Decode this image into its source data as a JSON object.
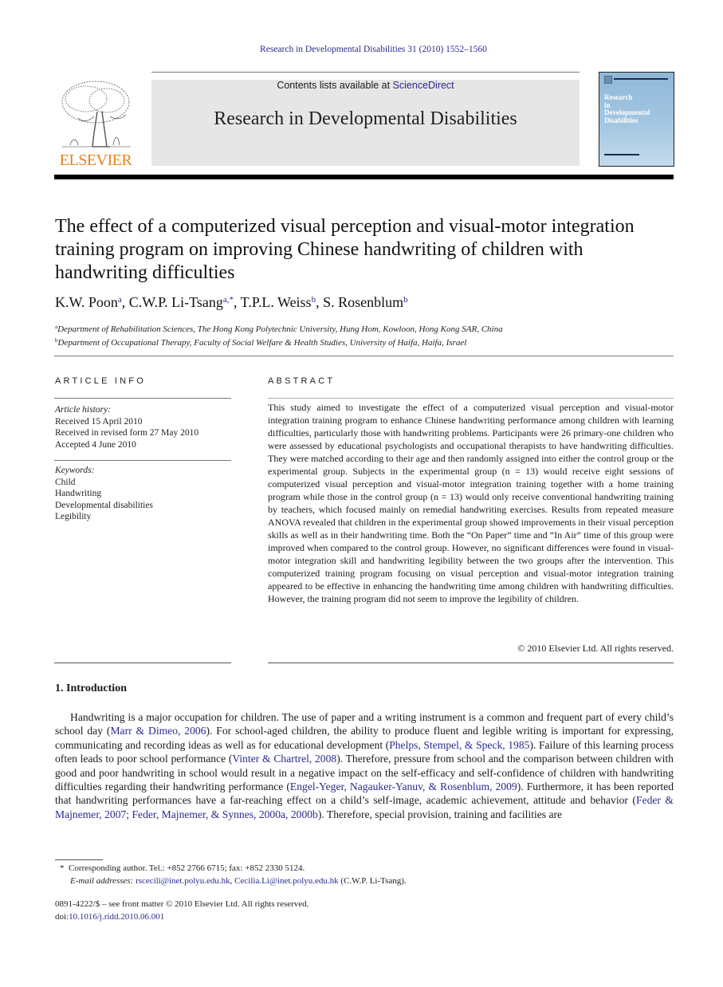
{
  "header": {
    "journal_ref": "Research in Developmental Disabilities 31 (2010) 1552–1560",
    "contents_prefix": "Contents lists available at ",
    "contents_link": "ScienceDirect",
    "journal_title": "Research in Developmental Disabilities",
    "publisher": "ELSEVIER",
    "cover_title": [
      "Research",
      "in",
      "Developmental",
      "Disabilities"
    ],
    "colors": {
      "publisher_orange": "#e8821e",
      "link_blue": "#2a2a8c",
      "banner_gray": "#e6e6e6",
      "cover_blue": "#a6c8e2"
    }
  },
  "article": {
    "title": "The effect of a computerized visual perception and visual-motor integration training program on improving Chinese handwriting of children with handwriting difficulties",
    "authors": [
      {
        "name": "K.W. Poon",
        "sup": "a",
        "sep": ", "
      },
      {
        "name": "C.W.P. Li-Tsang",
        "sup": "a,*",
        "sep": ", "
      },
      {
        "name": "T.P.L. Weiss",
        "sup": "b",
        "sep": ", "
      },
      {
        "name": "S. Rosenblum",
        "sup": "b",
        "sep": ""
      }
    ],
    "affiliations": [
      {
        "sup": "a",
        "text": "Department of Rehabilitation Sciences, The Hong Kong Polytechnic University, Hung Hom, Kowloon, Hong Kong SAR, China"
      },
      {
        "sup": "b",
        "text": "Department of Occupational Therapy, Faculty of Social Welfare & Health Studies, University of Haifa, Haifa, Israel"
      }
    ]
  },
  "article_info": {
    "heading": "ARTICLE INFO",
    "history_label": "Article history:",
    "history": [
      "Received 15 April 2010",
      "Received in revised form 27 May 2010",
      "Accepted 4 June 2010"
    ],
    "keywords_label": "Keywords:",
    "keywords": [
      "Child",
      "Handwriting",
      "Developmental disabilities",
      "Legibility"
    ]
  },
  "abstract": {
    "heading": "ABSTRACT",
    "text": "This study aimed to investigate the effect of a computerized visual perception and visual-motor integration training program to enhance Chinese handwriting performance among children with learning difficulties, particularly those with handwriting problems. Participants were 26 primary-one children who were assessed by educational psychologists and occupational therapists to have handwriting difficulties. They were matched according to their age and then randomly assigned into either the control group or the experimental group. Subjects in the experimental group (n = 13) would receive eight sessions of computerized visual perception and visual-motor integration training together with a home training program while those in the control group (n = 13) would only receive conventional handwriting training by teachers, which focused mainly on remedial handwriting exercises. Results from repeated measure ANOVA revealed that children in the experimental group showed improvements in their visual perception skills as well as in their handwriting time. Both the “On Paper” time and “In Air” time of this group were improved when compared to the control group. However, no significant differences were found in visual-motor integration skill and handwriting legibility between the two groups after the intervention. This computerized training program focusing on visual perception and visual-motor integration training appeared to be effective in enhancing the handwriting time among children with handwriting difficulties. However, the training program did not seem to improve the legibility of children.",
    "copyright": "© 2010 Elsevier Ltd. All rights reserved."
  },
  "introduction": {
    "heading": "1.  Introduction",
    "segments": [
      {
        "t": "Handwriting is a major occupation for children. The use of paper and a writing instrument is a common and frequent part of every child’s school day ("
      },
      {
        "t": "Marr & Dimeo, 2006",
        "link": true
      },
      {
        "t": "). For school-aged children, the ability to produce fluent and legible writing is important for expressing, communicating and recording ideas as well as for educational development ("
      },
      {
        "t": "Phelps, Stempel, & Speck, 1985",
        "link": true
      },
      {
        "t": "). Failure of this learning process often leads to poor school performance ("
      },
      {
        "t": "Vinter & Chartrel, 2008",
        "link": true
      },
      {
        "t": "). Therefore, pressure from school and the comparison between children with good and poor handwriting in school would result in a negative impact on the self-efficacy and self-confidence of children with handwriting difficulties regarding their handwriting performance ("
      },
      {
        "t": "Engel-Yeger, Nagauker-Yanuv, & Rosenblum, 2009",
        "link": true
      },
      {
        "t": "). Furthermore, it has been reported that handwriting performances have a far-reaching effect on a child’s self-image, academic achievement, attitude and behavior ("
      },
      {
        "t": "Feder & Majnemer, 2007; Feder, Majnemer, & Synnes, 2000a, 2000b",
        "link": true
      },
      {
        "t": "). Therefore, special provision, training and facilities are"
      }
    ]
  },
  "footnotes": {
    "star": "*",
    "corresponding": "Corresponding author. Tel.: +852 2766 6715; fax: +852 2330 5124.",
    "email_label": "E-mail addresses: ",
    "email1": "rscecili@inet.polyu.edu.hk",
    "email_sep": ", ",
    "email2": "Cecilia.Li@inet.polyu.edu.hk",
    "email_owner": " (C.W.P. Li-Tsang).",
    "front_matter": "0891-4222/$ – see front matter © 2010 Elsevier Ltd. All rights reserved.",
    "doi_label": "doi:",
    "doi": "10.1016/j.ridd.2010.06.001"
  }
}
